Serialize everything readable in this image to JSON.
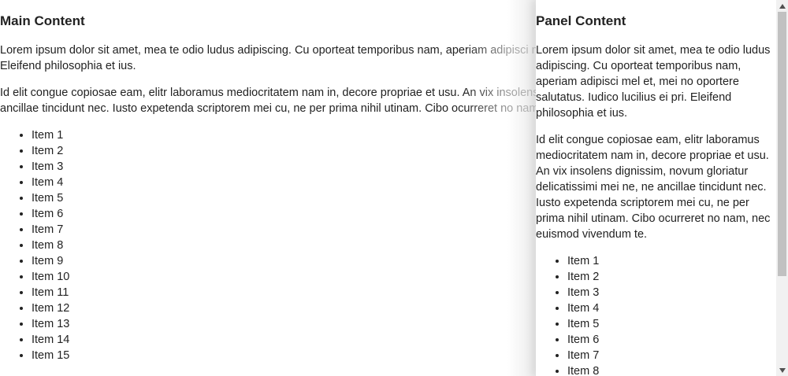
{
  "main": {
    "title": "Main Content",
    "paragraphs": [
      {
        "lines": [
          "Lorem ipsum dolor sit amet, mea te odio ludus adipiscing. Cu oporteat temporibus nam, aperiam adipisci mel et, mei no oportere salutatus. Iudico lucilius ei pri.",
          "Eleifend philosophia et ius."
        ]
      },
      {
        "lines": [
          "Id elit congue copiosae eam, elitr laboramus mediocritatem nam in, decore propriae et usu. An vix insolens dignissim, novum gloriatur delicatissimi mei ne, ne",
          "ancillae tincidunt nec. Iusto expetenda scriptorem mei cu, ne per prima nihil utinam. Cibo ocurreret no nam, nec euismod vivendum te."
        ]
      }
    ],
    "items": [
      "Item 1",
      "Item 2",
      "Item 3",
      "Item 4",
      "Item 5",
      "Item 6",
      "Item 7",
      "Item 8",
      "Item 9",
      "Item 10",
      "Item 11",
      "Item 12",
      "Item 13",
      "Item 14",
      "Item 15"
    ]
  },
  "panel": {
    "title": "Panel Content",
    "paragraphs": [
      "Lorem ipsum dolor sit amet, mea te odio ludus adipiscing. Cu oporteat temporibus nam, aperiam adipisci mel et, mei no oportere salutatus. Iudico lucilius ei pri. Eleifend philosophia et ius.",
      "Id elit congue copiosae eam, elitr laboramus mediocritatem nam in, decore propriae et usu. An vix insolens dignissim, novum gloriatur delicatissimi mei ne, ne ancillae tincidunt nec. Iusto expetenda scriptorem mei cu, ne per prima nihil utinam. Cibo ocurreret no nam, nec euismod vivendum te."
    ],
    "items": [
      "Item 1",
      "Item 2",
      "Item 3",
      "Item 4",
      "Item 5",
      "Item 6",
      "Item 7",
      "Item 8"
    ]
  },
  "scrollbar": {
    "up_icon": "triangle-up-icon",
    "down_icon": "triangle-down-icon",
    "scroll_position": 0
  }
}
